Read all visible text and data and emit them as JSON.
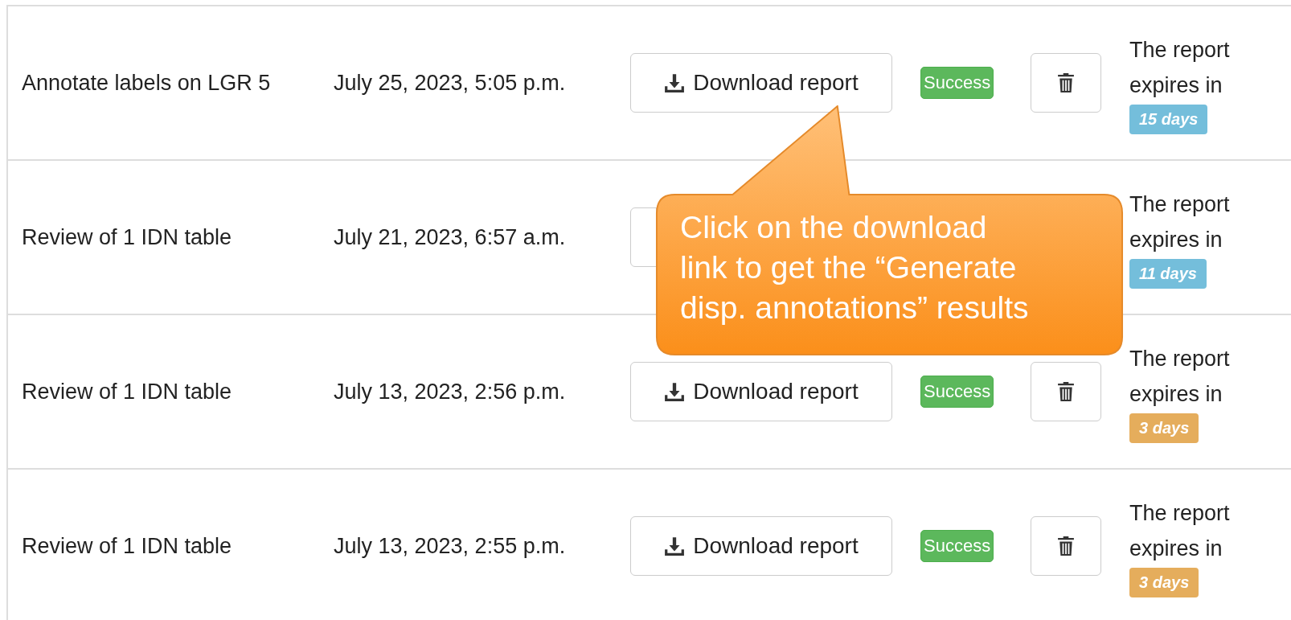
{
  "rows": [
    {
      "task": "Annotate labels on LGR 5",
      "date": "July 25, 2023, 5:05 p.m.",
      "download_button": true,
      "download_label": "Download report",
      "status": "Success",
      "delete_button": true,
      "expiry_text": "The report expires in",
      "expiry": {
        "label": "15 days",
        "color": "#74bedb"
      }
    },
    {
      "task": "Review of 1 IDN table",
      "date": "July 21, 2023, 6:57 a.m.",
      "download_button": true,
      "delete_button": false,
      "expiry_text": "The report expires in",
      "expiry": {
        "label": "11 days",
        "color": "#74bedb"
      }
    },
    {
      "task": "Review of 1 IDN table",
      "date": "July 13, 2023, 2:56 p.m.",
      "download_button": true,
      "download_label": "Download report",
      "status": "Success",
      "delete_button": true,
      "expiry_text": "The report expires in",
      "expiry": {
        "label": "3 days",
        "color": "#e5ad5c"
      }
    },
    {
      "task": "Review of 1 IDN table",
      "date": "July 13, 2023, 2:55 p.m.",
      "download_button": true,
      "download_label": "Download report",
      "status": "Success",
      "delete_button": true,
      "expiry_text": "The report expires in",
      "expiry": {
        "label": "3 days",
        "color": "#e5ad5c"
      }
    }
  ],
  "callout": {
    "lines": [
      "Click on the download",
      "link to get the “Generate",
      "disp. annotations” results"
    ]
  }
}
